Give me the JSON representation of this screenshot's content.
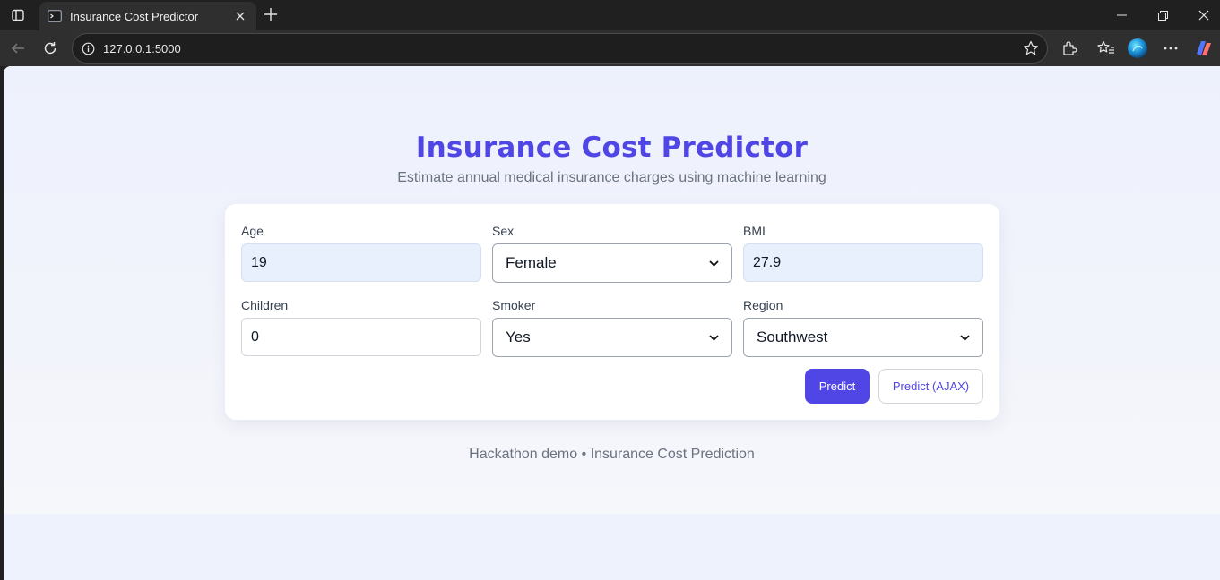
{
  "browser": {
    "tab_title": "Insurance Cost Predictor",
    "url": "127.0.0.1:5000",
    "icons": [
      "tab-actions-icon",
      "terminal-favicon-icon",
      "close-icon",
      "plus-icon",
      "minimize-icon",
      "restore-icon",
      "close-window-icon",
      "back-icon",
      "refresh-icon",
      "info-icon",
      "star-icon",
      "extensions-icon",
      "favorites-icon",
      "profile-icon",
      "more-icon",
      "copilot-icon"
    ]
  },
  "page": {
    "title": "Insurance Cost Predictor",
    "subtitle": "Estimate annual medical insurance charges using machine learning",
    "footer": "Hackathon demo • Insurance Cost Prediction"
  },
  "form": {
    "age": {
      "label": "Age",
      "value": "19"
    },
    "sex": {
      "label": "Sex",
      "value": "Female"
    },
    "bmi": {
      "label": "BMI",
      "value": "27.9"
    },
    "children": {
      "label": "Children",
      "value": "0"
    },
    "smoker": {
      "label": "Smoker",
      "value": "Yes"
    },
    "region": {
      "label": "Region",
      "value": "Southwest"
    },
    "predict_label": "Predict",
    "predict_ajax_label": "Predict (AJAX)"
  },
  "colors": {
    "accent": "#4f46e5",
    "page_bg": "#eef2fc",
    "filled_input_bg": "#e8effd",
    "muted_text": "#6b7280"
  }
}
